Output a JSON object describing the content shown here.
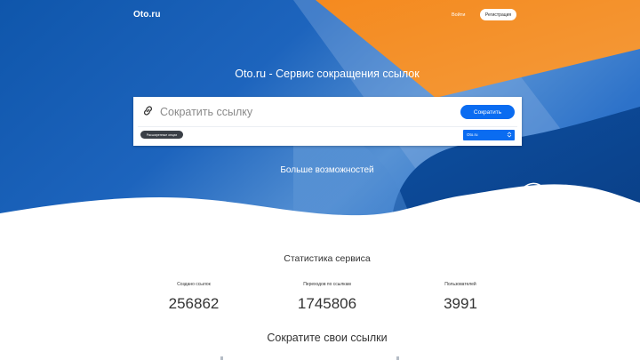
{
  "header": {
    "logo": "Oto.ru",
    "login": "Войти",
    "register": "Регистрация"
  },
  "hero": {
    "title": "Oto.ru - Сервис сокращения ссылок",
    "input_placeholder": "Сократить ссылку",
    "shorten_button": "Сократить",
    "advanced_options": "Расширенные опции",
    "domain_selected": "Oto.ru",
    "more_features": "Больше возможностей"
  },
  "stats": {
    "title": "Статистика сервиса",
    "items": [
      {
        "label": "Создано ссылок",
        "value": "256862"
      },
      {
        "label": "Переходов по ссылкам",
        "value": "1745806"
      },
      {
        "label": "Пользователей",
        "value": "3991"
      }
    ]
  },
  "shorten_section": {
    "title": "Сократите свои ссылки"
  },
  "colors": {
    "hero_blue": "#1a5fb4",
    "accent_orange": "#f28a2a",
    "button_blue": "#0a6cf1"
  }
}
